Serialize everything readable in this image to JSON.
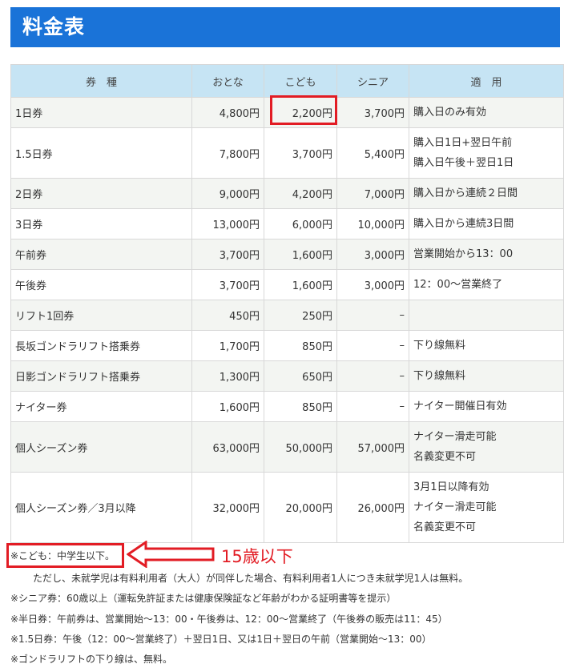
{
  "title": "料金表",
  "headers": [
    "券　種",
    "おとな",
    "こども",
    "シニア",
    "適　用"
  ],
  "rows": [
    {
      "name": "1日券",
      "adult": "4,800円",
      "child": "2,200円",
      "senior": "3,700円",
      "apply": [
        "購入日のみ有効"
      ]
    },
    {
      "name": "1.5日券",
      "adult": "7,800円",
      "child": "3,700円",
      "senior": "5,400円",
      "apply": [
        "購入日1日+翌日午前",
        "購入日午後＋翌日1日"
      ]
    },
    {
      "name": "2日券",
      "adult": "9,000円",
      "child": "4,200円",
      "senior": "7,000円",
      "apply": [
        "購入日から連続２日間"
      ]
    },
    {
      "name": "3日券",
      "adult": "13,000円",
      "child": "6,000円",
      "senior": "10,000円",
      "apply": [
        "購入日から連続3日間"
      ]
    },
    {
      "name": "午前券",
      "adult": "3,700円",
      "child": "1,600円",
      "senior": "3,000円",
      "apply": [
        "営業開始から13：00"
      ]
    },
    {
      "name": "午後券",
      "adult": "3,700円",
      "child": "1,600円",
      "senior": "3,000円",
      "apply": [
        "12：00～営業終了"
      ]
    },
    {
      "name": "リフト1回券",
      "adult": "450円",
      "child": "250円",
      "senior": "–",
      "apply": []
    },
    {
      "name": "長坂ゴンドラリフト搭乗券",
      "adult": "1,700円",
      "child": "850円",
      "senior": "–",
      "apply": [
        "下り線無料"
      ]
    },
    {
      "name": "日影ゴンドラリフト搭乗券",
      "adult": "1,300円",
      "child": "650円",
      "senior": "–",
      "apply": [
        "下り線無料"
      ]
    },
    {
      "name": "ナイター券",
      "adult": "1,600円",
      "child": "850円",
      "senior": "–",
      "apply": [
        "ナイター開催日有効"
      ]
    },
    {
      "name": "個人シーズン券",
      "adult": "63,000円",
      "child": "50,000円",
      "senior": "57,000円",
      "apply": [
        "ナイター滑走可能",
        "名義変更不可"
      ]
    },
    {
      "name": "個人シーズン券／3月以降",
      "adult": "32,000円",
      "child": "20,000円",
      "senior": "26,000円",
      "apply": [
        "3月1日以降有効",
        "ナイター滑走可能",
        "名義変更不可"
      ]
    }
  ],
  "notes": {
    "child": "※こども：中学生以下。",
    "child_sub": "ただし、未就学児は有料利用者（大人）が同伴した場合、有料利用者1人につき未就学児1人は無料。",
    "senior": "※シニア券：60歳以上（運転免許証または健康保険証など年齢がわかる証明書等を提示）",
    "half": "※半日券：午前券は、営業開始～13：00・午後券は、12：00～営業終了（午後券の販売は11：45）",
    "one_half": "※1.5日券：午後（12：00～営業終了）＋翌日1日、又は1日＋翌日の午前（営業開始～13：00）",
    "gondola": "※ゴンドラリフトの下り線は、無料。"
  },
  "annotation": "15歳以下",
  "colors": {
    "header_bg": "#1a73d8",
    "th_bg": "#c6e4f4",
    "highlight": "#e21c24",
    "alt_row": "#f3f5f2"
  }
}
